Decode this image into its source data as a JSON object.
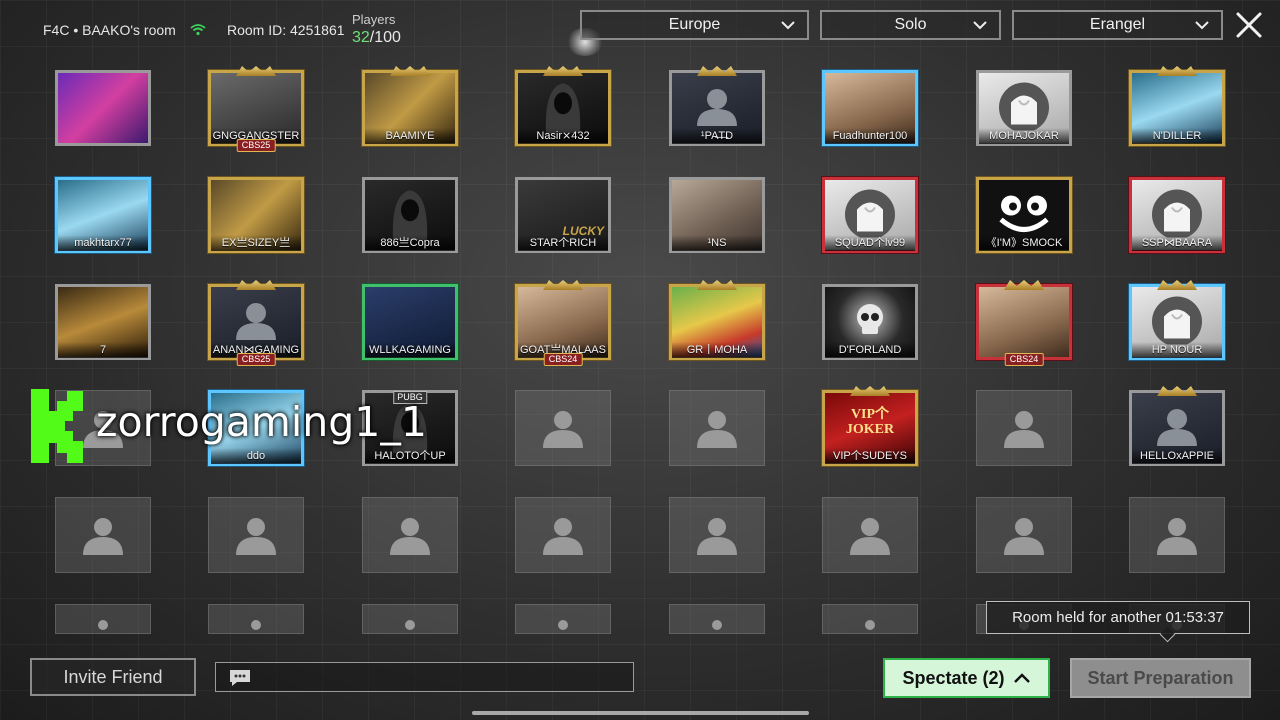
{
  "header": {
    "room_name": "F4C • BAAKO's room",
    "room_id": "Room ID: 4251861",
    "players_label": "Players",
    "players_current": "32",
    "players_max": "/100"
  },
  "filters": {
    "region": "Europe",
    "mode": "Solo",
    "map": "Erangel"
  },
  "players": [
    {
      "name": "",
      "art": "a-purple",
      "frame": "silver"
    },
    {
      "name": "GNGGANGSTER",
      "art": "a-gray",
      "frame": "gold"
    },
    {
      "name": "BAAMIYE",
      "art": "a-gold",
      "frame": "gold"
    },
    {
      "name": "Nasir⨯432",
      "art": "a-dark",
      "frame": "gold"
    },
    {
      "name": "¹PA̶T̶D",
      "art": "a-gamer",
      "frame": "silver"
    },
    {
      "name": "Fuadhunter100",
      "art": "a-face",
      "frame": "blue"
    },
    {
      "name": "MOHAJOKAR",
      "art": "a-white",
      "frame": "silver"
    },
    {
      "name": "N'DILLER",
      "art": "a-teal",
      "frame": "gold"
    },
    {
      "name": "makhtarx77",
      "art": "a-teal",
      "frame": "blue"
    },
    {
      "name": "EX亗SIZEY亗",
      "art": "a-gold",
      "frame": "gold"
    },
    {
      "name": "886亗Copra",
      "art": "a-dark",
      "frame": "silver"
    },
    {
      "name": "STAR个RICH",
      "art": "a-lucky",
      "frame": "silver"
    },
    {
      "name": "¹NS",
      "art": "a-photo",
      "frame": "silver"
    },
    {
      "name": "SQUAD个lv99",
      "art": "a-white",
      "frame": "red"
    },
    {
      "name": "《I'M》SMOCK",
      "art": "a-smile",
      "frame": "gold"
    },
    {
      "name": "SSP⋈BAARA",
      "art": "a-white",
      "frame": "red"
    },
    {
      "name": "7",
      "art": "a-dragon",
      "frame": "silver"
    },
    {
      "name": "ANAN⋈GAMING",
      "art": "a-gamer",
      "frame": "gold"
    },
    {
      "name": "WLLKAGAMING",
      "art": "a-night",
      "frame": "green"
    },
    {
      "name": "GOAT亗MALAAS",
      "art": "a-face",
      "frame": "gold"
    },
    {
      "name": "GR丨MOHA",
      "art": "a-green",
      "frame": "gold"
    },
    {
      "name": "D'FORLAND",
      "art": "a-skull",
      "frame": "silver"
    },
    {
      "name": "",
      "art": "a-face",
      "frame": "red"
    },
    {
      "name": "HP NOUR",
      "art": "a-white",
      "frame": "blue"
    },
    {
      "name": "ddo",
      "art": "a-teal",
      "frame": "blue"
    },
    {
      "name": "HALOTO个UP",
      "art": "a-dark",
      "frame": "silver"
    },
    {
      "name": "VIP个SUDEYS",
      "art": "a-vip",
      "frame": "gold"
    },
    {
      "name": "HELLOxAPPIE",
      "art": "a-gamer",
      "frame": "silver"
    }
  ],
  "badges": {
    "cbs25": "CBS25",
    "cbs24": "CBS24",
    "pubg": "PUBG",
    "lucky": "LUCKY",
    "vip_line1": "VIP个",
    "vip_line2": "JOKER"
  },
  "watermark": {
    "text": "zorrogaming1_1"
  },
  "footer": {
    "room_held": "Room held for another 01:53:37",
    "invite_label": "Invite Friend",
    "chat_placeholder": "",
    "spectate_label": "Spectate (2)",
    "start_label": "Start Preparation"
  },
  "colors": {
    "accent_green": "#2fb24a",
    "player_count": "#6ee07a",
    "kick_green": "#53fc18"
  },
  "icons": [
    "wifi-icon",
    "chevron-down-icon",
    "close-icon",
    "person-placeholder-icon",
    "chat-icon",
    "chevron-up-icon",
    "kick-logo-icon"
  ]
}
